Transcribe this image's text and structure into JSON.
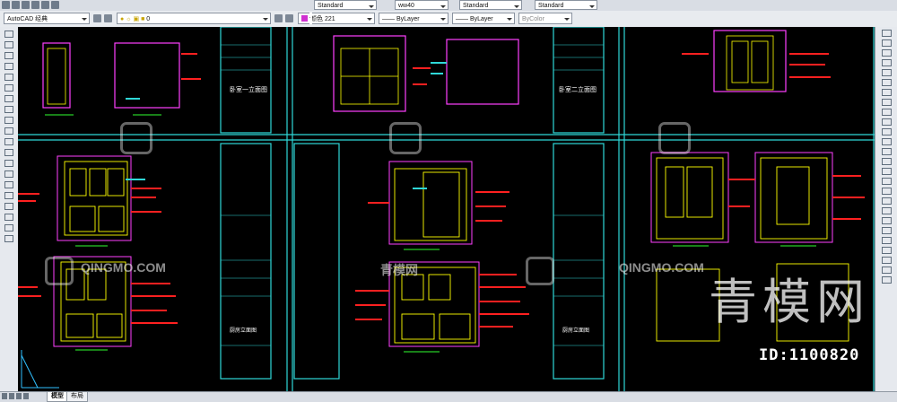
{
  "toolbar": {
    "workspace": "AutoCAD 经典",
    "layer_value": "0",
    "color_value": "颜色 221",
    "text_style": "Standard",
    "dim_style": "ww40",
    "table_style": "Standard",
    "mleader_style": "Standard",
    "linetype": "ByLayer",
    "lineweight": "ByLayer",
    "plotstyle": "ByColor"
  },
  "tabs": [
    {
      "label": "模型",
      "active": true
    },
    {
      "label": "布局",
      "active": false
    }
  ],
  "sheets": {
    "title_1": "卧室一立面图",
    "title_2": "卧室二立面图",
    "title_3": "厨房立面图",
    "title_4": "厨房立面图"
  },
  "watermarks": {
    "logo_text": "QINGMO.COM",
    "cn_text": "青模网",
    "big_text": "青模网",
    "id_text": "ID:1100820"
  },
  "colors": {
    "frame": "#2fd8d8",
    "dim": "#ff2020",
    "object": "#ffff00",
    "accent": "#ff40ff"
  }
}
